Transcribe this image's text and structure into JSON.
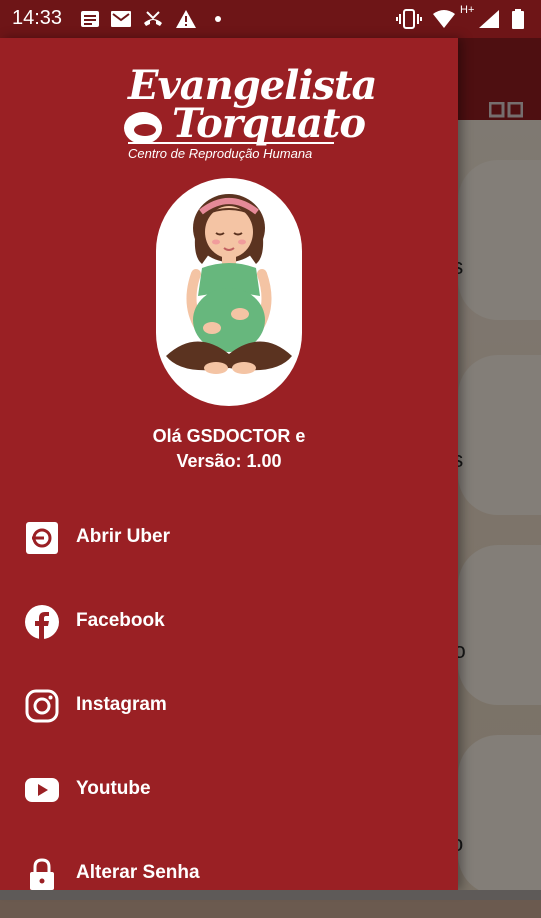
{
  "status_bar": {
    "time": "14:33",
    "icons": [
      "notes-icon",
      "mail-icon",
      "missed-call-icon",
      "warning-icon",
      "dot-icon",
      "vibrate-icon",
      "wifi-icon",
      "signal-icon",
      "battery-icon"
    ],
    "network": "H+"
  },
  "background": {
    "list_fragments": [
      "es",
      "es",
      "tro",
      "co"
    ]
  },
  "drawer": {
    "logo": {
      "line1": "Evangelista",
      "line2": "Torquato",
      "subtitle": "Centro de Reprodução Humana"
    },
    "greeting_line1": "Olá GSDOCTOR e",
    "greeting_line2": "Versão: 1.00",
    "menu": [
      {
        "label": "Abrir Uber",
        "icon": "uber-icon"
      },
      {
        "label": "Facebook",
        "icon": "facebook-icon"
      },
      {
        "label": "Instagram",
        "icon": "instagram-icon"
      },
      {
        "label": "Youtube",
        "icon": "youtube-icon"
      },
      {
        "label": "Alterar Senha",
        "icon": "lock-icon"
      }
    ]
  },
  "colors": {
    "drawer_bg": "#9a2024",
    "toolbar_bg": "#8e1c1f",
    "status_bg": "#6e1517",
    "text": "#ffffff"
  }
}
